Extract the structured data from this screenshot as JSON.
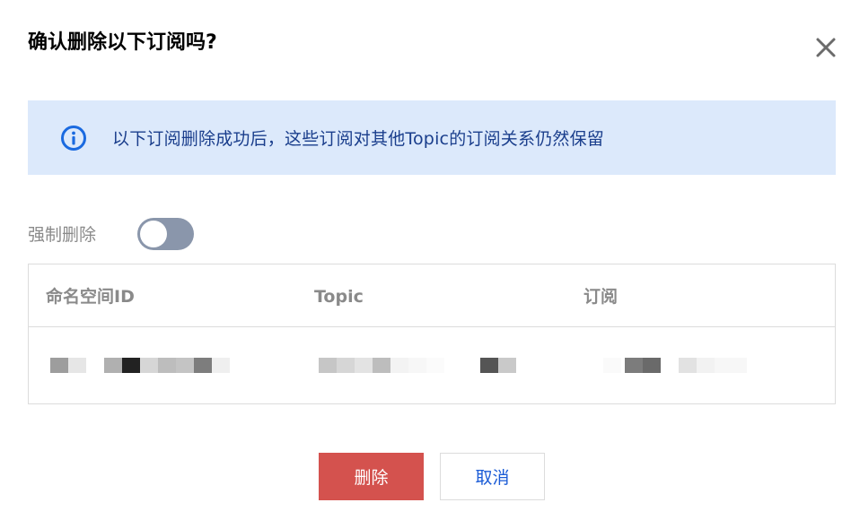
{
  "dialog": {
    "title": "确认删除以下订阅吗?",
    "notice": "以下订阅删除成功后，这些订阅对其他Topic的订阅关系仍然保留",
    "force_delete": {
      "label": "强制删除",
      "enabled": false
    }
  },
  "table": {
    "columns": [
      "命名空间ID",
      "Topic",
      "订阅"
    ],
    "rows": [
      {
        "namespace_id": "(redacted)",
        "topic": "(redacted)",
        "subscription": "(redacted)"
      }
    ]
  },
  "buttons": {
    "delete": "删除",
    "cancel": "取消"
  },
  "icons": {
    "info": "info-icon",
    "close": "close-icon"
  },
  "colors": {
    "notice_bg": "#dce9fb",
    "notice_text": "#1a3e8c",
    "info_icon": "#1a6ae0",
    "delete_button": "#d4524e",
    "cancel_text": "#1a5bd6",
    "toggle_off": "#8a96ab"
  }
}
